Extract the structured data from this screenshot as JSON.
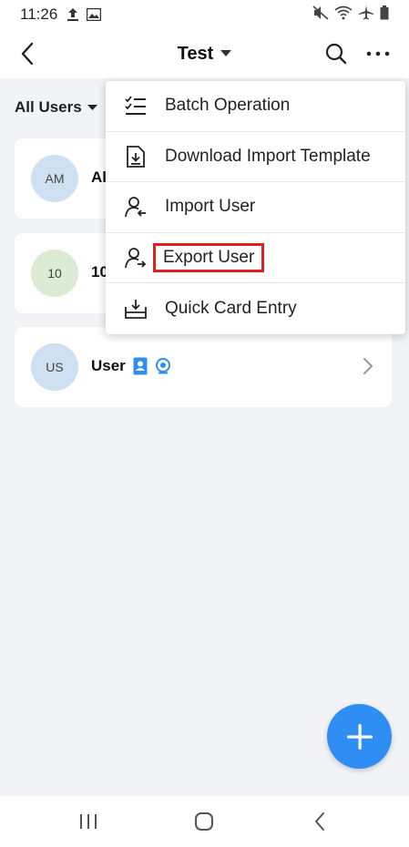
{
  "status_bar": {
    "time": "11:26"
  },
  "header": {
    "title": "Test"
  },
  "filter": {
    "label": "All Users"
  },
  "cards": [
    {
      "initials": "AM",
      "name": "Al",
      "avatar_color": "#cfe0f3"
    },
    {
      "initials": "10",
      "name": "10",
      "avatar_color": "#dcebd3"
    },
    {
      "initials": "US",
      "name": "User",
      "avatar_color": "#cfe0f3"
    }
  ],
  "menu": {
    "items": [
      {
        "label": "Batch Operation",
        "icon": "checklist-icon"
      },
      {
        "label": "Download Import Template",
        "icon": "download-file-icon"
      },
      {
        "label": "Import User",
        "icon": "import-user-icon"
      },
      {
        "label": "Export User",
        "icon": "export-user-icon",
        "highlighted": true
      },
      {
        "label": "Quick Card Entry",
        "icon": "tray-download-icon"
      }
    ]
  },
  "colors": {
    "accent": "#2f8ef4",
    "highlight_border": "#e02020",
    "background": "#f2f3f7"
  }
}
